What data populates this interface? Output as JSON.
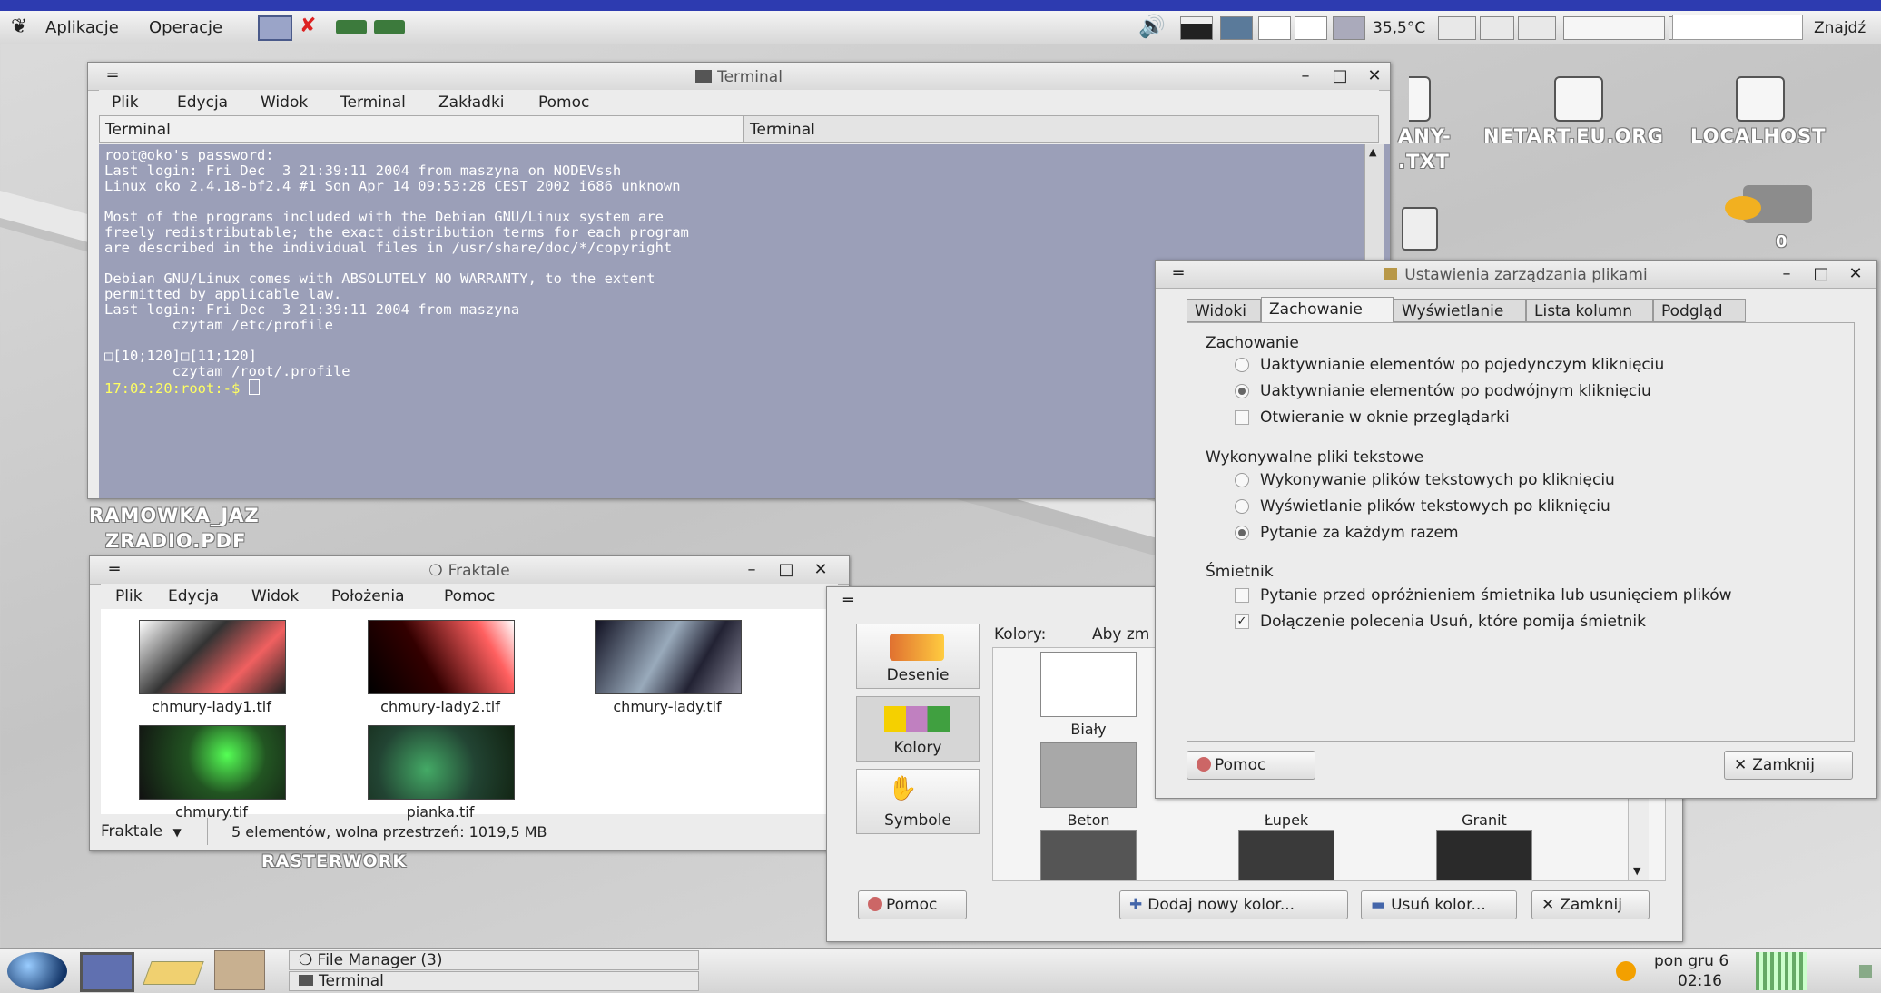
{
  "top_panel": {
    "menu_apps": "Aplikacje",
    "menu_ops": "Operacje",
    "temperature": "35,5°C",
    "search_label": "Znajdź"
  },
  "desktop": {
    "icon_any_line1": "ANY-",
    "icon_any_line2": ".TXT",
    "icon_netart": "NETART.EU.ORG",
    "icon_localhost": "LOCALHOST",
    "icon_zero": "0",
    "label_ramowka_line1": "RAMOWKA_JAZ",
    "label_ramowka_line2": "ZRADIO.PDF",
    "label_rasterwork": "RASTERWORK"
  },
  "terminal": {
    "title": "Terminal",
    "menu": [
      "Plik",
      "Edycja",
      "Widok",
      "Terminal",
      "Zakładki",
      "Pomoc"
    ],
    "tabs": [
      "Terminal",
      "Terminal"
    ],
    "lines": [
      "root@oko's password:",
      "Last login: Fri Dec  3 21:39:11 2004 from maszyna on NODEVssh",
      "Linux oko 2.4.18-bf2.4 #1 Son Apr 14 09:53:28 CEST 2002 i686 unknown",
      "",
      "Most of the programs included with the Debian GNU/Linux system are",
      "freely redistributable; the exact distribution terms for each program",
      "are described in the individual files in /usr/share/doc/*/copyright",
      "",
      "Debian GNU/Linux comes with ABSOLUTELY NO WARRANTY, to the extent",
      "permitted by applicable law.",
      "Last login: Fri Dec  3 21:39:11 2004 from maszyna",
      "        czytam /etc/profile",
      "",
      "□[10;120]□[11;120]",
      "        czytam /root/.profile"
    ],
    "prompt": "17:02:20:root:-$ "
  },
  "fraktale": {
    "title": "Fraktale",
    "menu": [
      "Plik",
      "Edycja",
      "Widok",
      "Położenia",
      "Pomoc"
    ],
    "files": [
      "chmury-lady1.tif",
      "chmury-lady2.tif",
      "chmury-lady.tif",
      "chmury.tif",
      "pianka.tif"
    ],
    "location": "Fraktale",
    "status": "5 elementów, wolna przestrzeń: 1019,5 MB"
  },
  "background_dialog": {
    "sidebar": [
      "Desenie",
      "Kolory",
      "Symbole"
    ],
    "colors_label": "Kolory:",
    "hint": "Aby zm",
    "swatches": [
      {
        "name": "Biały",
        "color": "#ffffff"
      },
      {
        "name": "Beton",
        "color": "#a8a8a8"
      },
      {
        "name": "Łupek",
        "color": "#3a3a3a"
      },
      {
        "name": "Granit",
        "color": "#2a2a2a"
      }
    ],
    "help_button": "Pomoc",
    "add_color_button": "Dodaj nowy kolor...",
    "remove_color_button": "Usuń kolor...",
    "close_button": "Zamknij"
  },
  "prefs_dialog": {
    "title": "Ustawienia zarządzania plikami",
    "tabs": [
      "Widoki",
      "Zachowanie",
      "Wyświetlanie",
      "Lista kolumn",
      "Podgląd"
    ],
    "section_behavior": "Zachowanie",
    "opt_single_click": "Uaktywnianie elementów po pojedynczym kliknięciu",
    "opt_double_click": "Uaktywnianie elementów po podwójnym kliknięciu",
    "opt_browser_window": "Otwieranie w oknie przeglądarki",
    "section_exec": "Wykonywalne pliki tekstowe",
    "opt_run_exec": "Wykonywanie plików tekstowych po kliknięciu",
    "opt_show_exec": "Wyświetlanie plików tekstowych po kliknięciu",
    "opt_ask_exec": "Pytanie za każdym razem",
    "section_trash": "Śmietnik",
    "opt_ask_trash": "Pytanie przed opróżnieniem śmietnika lub usunięciem plików",
    "opt_delete_cmd": "Dołączenie polecenia Usuń, które pomija śmietnik",
    "help_button": "Pomoc",
    "close_button": "Zamknij"
  },
  "bottom_panel": {
    "task_file_manager": "File Manager (3)",
    "task_terminal": "Terminal",
    "clock_day": "pon gru  6",
    "clock_time": "02:16"
  }
}
